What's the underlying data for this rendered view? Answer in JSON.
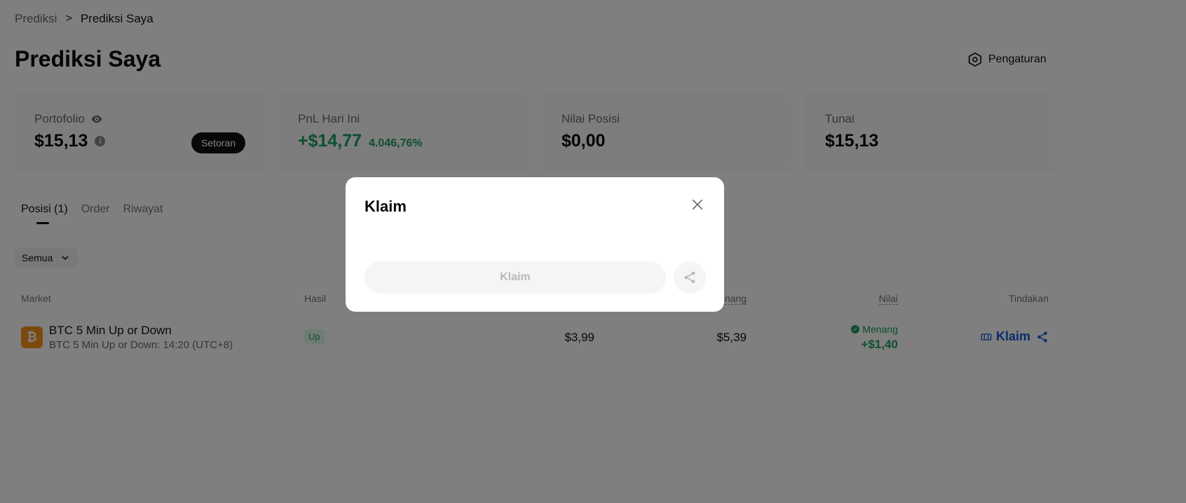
{
  "breadcrumb": {
    "parent": "Prediksi",
    "separator": ">",
    "current": "Prediksi Saya"
  },
  "header": {
    "title": "Prediksi Saya",
    "settings_label": "Pengaturan",
    "settings_icon": "settings-hex-icon"
  },
  "cards": {
    "portfolio": {
      "label": "Portofolio",
      "value": "$15,13",
      "deposit_label": "Setoran",
      "eye_icon": "eye-icon",
      "info_icon": "info-icon"
    },
    "pnl": {
      "label": "PnL Hari Ini",
      "value": "+$14,77",
      "percent": "4.046,76%"
    },
    "position_value": {
      "label": "Nilai Posisi",
      "value": "$0,00"
    },
    "cash": {
      "label": "Tunai",
      "value": "$15,13"
    }
  },
  "tabs": [
    {
      "label": "Posisi (1)",
      "active": true
    },
    {
      "label": "Order",
      "active": false
    },
    {
      "label": "Riwayat",
      "active": false
    }
  ],
  "filter": {
    "selected": "Semua"
  },
  "table": {
    "headers": {
      "market": "Market",
      "outcome": "Hasil",
      "win": "Menang",
      "value": "Nilai",
      "action": "Tindakan"
    },
    "rows": [
      {
        "coin_symbol": "₿",
        "title": "BTC 5 Min Up or Down",
        "subtitle": "BTC 5 Min Up or Down: 14:20 (UTC+8)",
        "outcome": "Up",
        "cost": "$3,99",
        "payout": "$5,39",
        "status": "Menang",
        "value": "+$1,40",
        "action_label": "Klaim"
      }
    ]
  },
  "modal": {
    "title": "Klaim",
    "claim_button": "Klaim",
    "close_icon": "close-icon",
    "share_icon": "share-icon"
  },
  "colors": {
    "accent_green": "#1a9f5c",
    "link_blue": "#1459d4",
    "bitcoin_orange": "#f7931a"
  }
}
